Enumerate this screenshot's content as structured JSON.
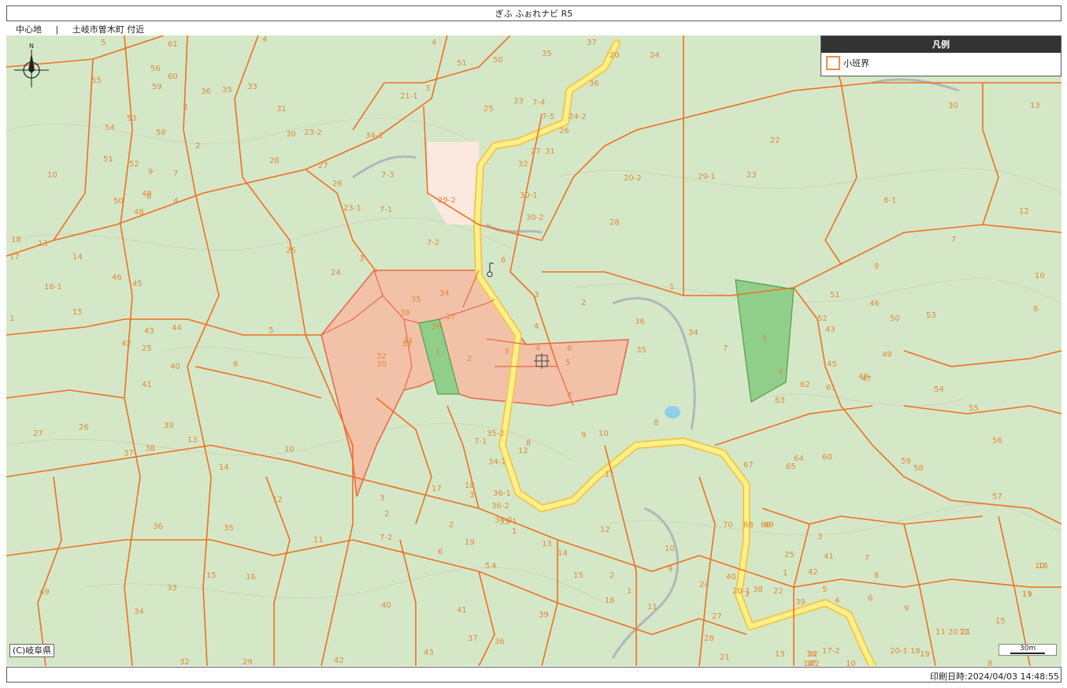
{
  "title": "ぎふ ふぉれナビ R5",
  "center": {
    "label": "中心地",
    "separator": "|",
    "location": "土岐市曽木町 付近"
  },
  "legend": {
    "heading": "凡例",
    "items": [
      {
        "label": "小班界",
        "color": "#f08a4b"
      }
    ]
  },
  "credit": "(C)岐阜県",
  "scale_label": "30m",
  "print_datetime": "印刷日時:2024/04/03 14:48:55",
  "colors": {
    "map_base": "#d4e8c8",
    "boundary": "#f07020",
    "selected_fill": "#f2c2a8",
    "selected_outline": "#e86a4a",
    "green_highlight": "#8fcf8a",
    "road_fill": "#fff08a",
    "road_edge": "#f0c850",
    "clearing": "#fbe9e0"
  },
  "parcel_labels": [
    "5",
    "4",
    "61",
    "55",
    "56",
    "60",
    "59",
    "36",
    "35",
    "33",
    "31",
    "53",
    "58",
    "1",
    "54",
    "2",
    "51",
    "52",
    "9",
    "7",
    "10",
    "50",
    "49",
    "48",
    "8",
    "4",
    "13",
    "18",
    "14",
    "17",
    "16-1",
    "46",
    "45",
    "15",
    "1",
    "43",
    "44",
    "42",
    "25",
    "41",
    "40",
    "39",
    "27",
    "26",
    "37",
    "38",
    "13",
    "14",
    "35",
    "36",
    "33",
    "15",
    "16",
    "49",
    "34",
    "32",
    "29",
    "30",
    "23-2",
    "28",
    "27",
    "26",
    "23-1",
    "25",
    "24",
    "3",
    "5",
    "6",
    "10",
    "11",
    "12",
    "2",
    "3",
    "4",
    "51",
    "50",
    "35",
    "37",
    "20",
    "24",
    "21-1",
    "3",
    "7-4",
    "36",
    "25",
    "33",
    "34-1",
    "7-3",
    "7-5",
    "24-2",
    "26",
    "27",
    "31",
    "32",
    "30-1",
    "30-2",
    "29-2",
    "7-1",
    "7-2",
    "6",
    "20-2",
    "28",
    "29-1",
    "23",
    "22",
    "30",
    "13",
    "6-1",
    "12",
    "7",
    "10",
    "8",
    "9",
    "51",
    "46",
    "50",
    "53",
    "52",
    "43",
    "45",
    "47",
    "49",
    "48",
    "54",
    "55",
    "56",
    "57",
    "59",
    "58",
    "60",
    "64",
    "62",
    "61",
    "63",
    "65",
    "67",
    "66",
    "69",
    "68",
    "70",
    "2",
    "1",
    "3",
    "4",
    "5",
    "6",
    "7",
    "8",
    "9",
    "11",
    "12",
    "15",
    "16",
    "19",
    "17-1",
    "17-2",
    "20-1",
    "10",
    "8",
    "9",
    "10",
    "11",
    "12",
    "13",
    "14",
    "16",
    "17",
    "18",
    "19",
    "20",
    "21",
    "22",
    "30",
    "31",
    "32",
    "33",
    "34",
    "35",
    "36",
    "37",
    "38",
    "1",
    "2",
    "3",
    "4",
    "5",
    "6",
    "7",
    "8",
    "9",
    "10",
    "11",
    "12",
    "13",
    "14",
    "15",
    "16",
    "17",
    "18",
    "19",
    "36-1",
    "36-2",
    "35-1",
    "35-2",
    "34-1",
    "34-2",
    "1",
    "2",
    "3",
    "7-1",
    "7-2",
    "5",
    "6",
    "4",
    "40",
    "41",
    "42",
    "43",
    "39",
    "36",
    "37",
    "2",
    "1",
    "11",
    "10",
    "9",
    "12",
    "24",
    "27",
    "28",
    "21",
    "20-1",
    "22",
    "25",
    "42",
    "41",
    "40",
    "38",
    "39",
    "36",
    "34",
    "35",
    "4",
    "3",
    "2",
    "1",
    "5",
    "6",
    "7",
    "8"
  ]
}
